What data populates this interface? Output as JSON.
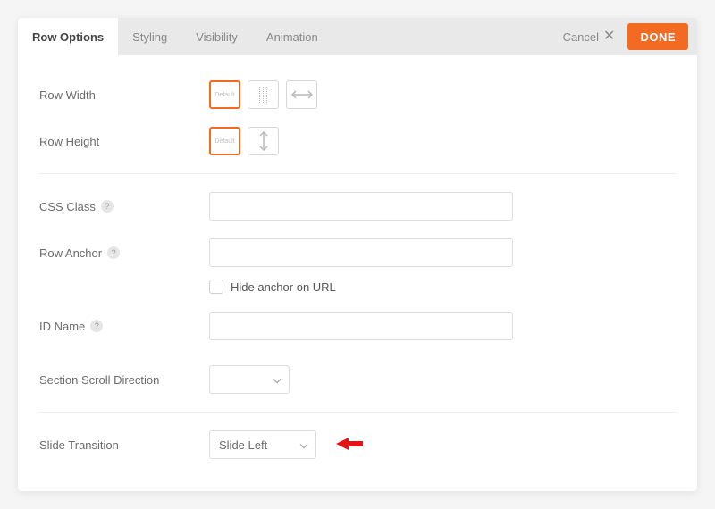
{
  "tabs": {
    "row_options": "Row Options",
    "styling": "Styling",
    "visibility": "Visibility",
    "animation": "Animation"
  },
  "actions": {
    "cancel": "Cancel",
    "done": "DONE"
  },
  "labels": {
    "row_width": "Row Width",
    "row_height": "Row Height",
    "css_class": "CSS Class",
    "row_anchor": "Row Anchor",
    "hide_anchor": "Hide anchor on URL",
    "id_name": "ID Name",
    "section_scroll": "Section Scroll Direction",
    "slide_transition": "Slide Transition"
  },
  "icons": {
    "default": "Default"
  },
  "fields": {
    "css_class": "",
    "row_anchor": "",
    "id_name": "",
    "section_scroll": "",
    "slide_transition": "Slide Left"
  }
}
